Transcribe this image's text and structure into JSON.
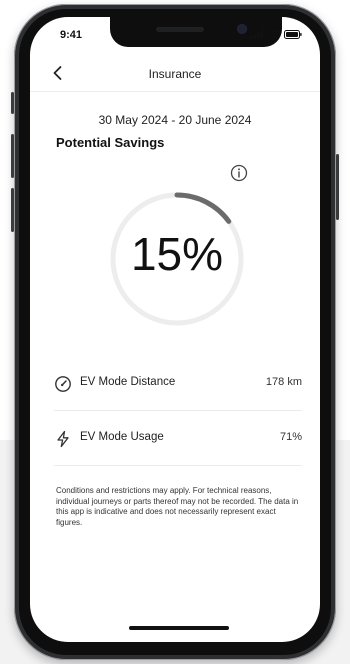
{
  "status_bar": {
    "time": "9:41"
  },
  "header": {
    "title": "Insurance"
  },
  "period": {
    "date_range": "30 May 2024 - 20 June 2024"
  },
  "savings": {
    "title": "Potential Savings",
    "percent_label": "15%",
    "progress_fraction": 0.15
  },
  "metrics": [
    {
      "icon": "gauge-icon",
      "label": "EV Mode Distance",
      "value": "178 km"
    },
    {
      "icon": "lightning-icon",
      "label": "EV Mode Usage",
      "value": "71%"
    }
  ],
  "disclaimer": "Conditions and restrictions may apply. For technical reasons, individual journeys or parts thereof may not be recorded. The data in this app is indicative and does not necessarily represent exact figures.",
  "colors": {
    "progress_track": "#ededed",
    "progress_fill": "#6b6b6b",
    "background": "#ffffff"
  }
}
